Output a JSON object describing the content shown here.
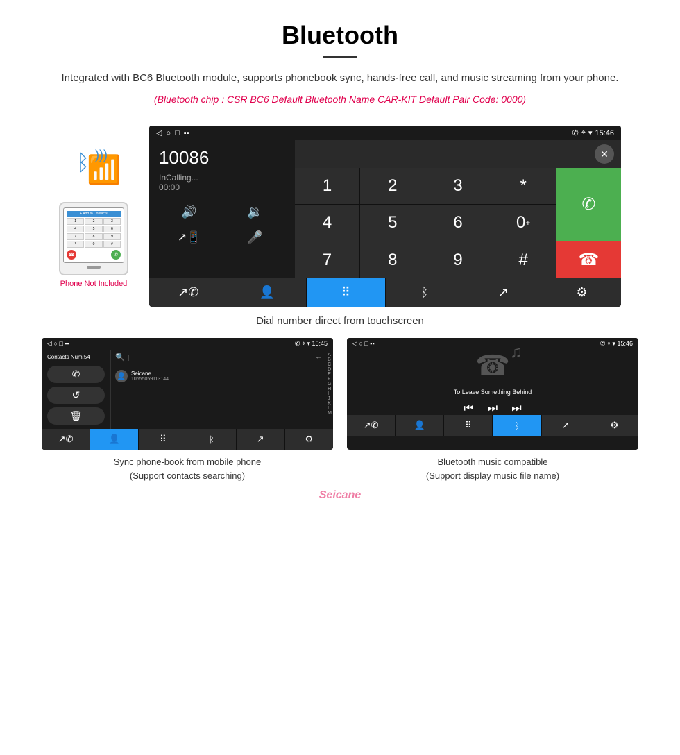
{
  "page": {
    "title": "Bluetooth",
    "divider": true,
    "description": "Integrated with BC6 Bluetooth module, supports phonebook sync, hands-free call, and music streaming from your phone.",
    "specs": "(Bluetooth chip : CSR BC6    Default Bluetooth Name CAR-KIT    Default Pair Code: 0000)",
    "caption_main": "Dial number direct from touchscreen",
    "caption_contacts": "Sync phone-book from mobile phone\n(Support contacts searching)",
    "caption_music": "Bluetooth music compatible\n(Support display music file name)",
    "phone_not_included": "Phone Not Included",
    "watermark": "Seicane"
  },
  "dial_screen": {
    "status_bar": {
      "left": [
        "◁",
        "○",
        "□",
        "▪▪"
      ],
      "right": [
        "✆",
        "⌖",
        "▾",
        "15:46"
      ]
    },
    "number": "10086",
    "status": "InCalling...",
    "timer": "00:00",
    "keypad": [
      "1",
      "2",
      "3",
      "*",
      "4",
      "5",
      "6",
      "0+",
      "7",
      "8",
      "9",
      "#"
    ],
    "green_call": "✆",
    "red_call": "☎",
    "bottom_nav": [
      "✆↗",
      "👤",
      "⠿",
      "ᛒ",
      "↗",
      "⚙"
    ]
  },
  "contacts_screen": {
    "status_bar_left": "◁  ○  □  ▪▪",
    "status_bar_right": "✆ ⌖ ▾ 15:45",
    "contacts_count": "Contacts Num:54",
    "contact_name": "Seicane",
    "contact_number": "10655059113144",
    "actions": [
      "✆",
      "↺",
      "🗑"
    ],
    "alpha_index": [
      "A",
      "B",
      "C",
      "D",
      "E",
      "F",
      "G",
      "H",
      "I",
      "J",
      "K",
      "L",
      "M"
    ],
    "bottom_nav": [
      "✆↗",
      "👤",
      "⠿",
      "ᛒ",
      "↗",
      "⚙"
    ],
    "active_nav": 1
  },
  "music_screen": {
    "status_bar_left": "◁  ○  □  ▪▪",
    "status_bar_right": "✆ ⌖ ▾ 15:46",
    "song_title": "To Leave Something Behind",
    "controls": [
      "⏮",
      "⏭",
      "⏭⏭"
    ],
    "bottom_nav": [
      "✆↗",
      "👤",
      "⠿",
      "ᛒ",
      "↗",
      "⚙"
    ],
    "active_nav": 3
  }
}
